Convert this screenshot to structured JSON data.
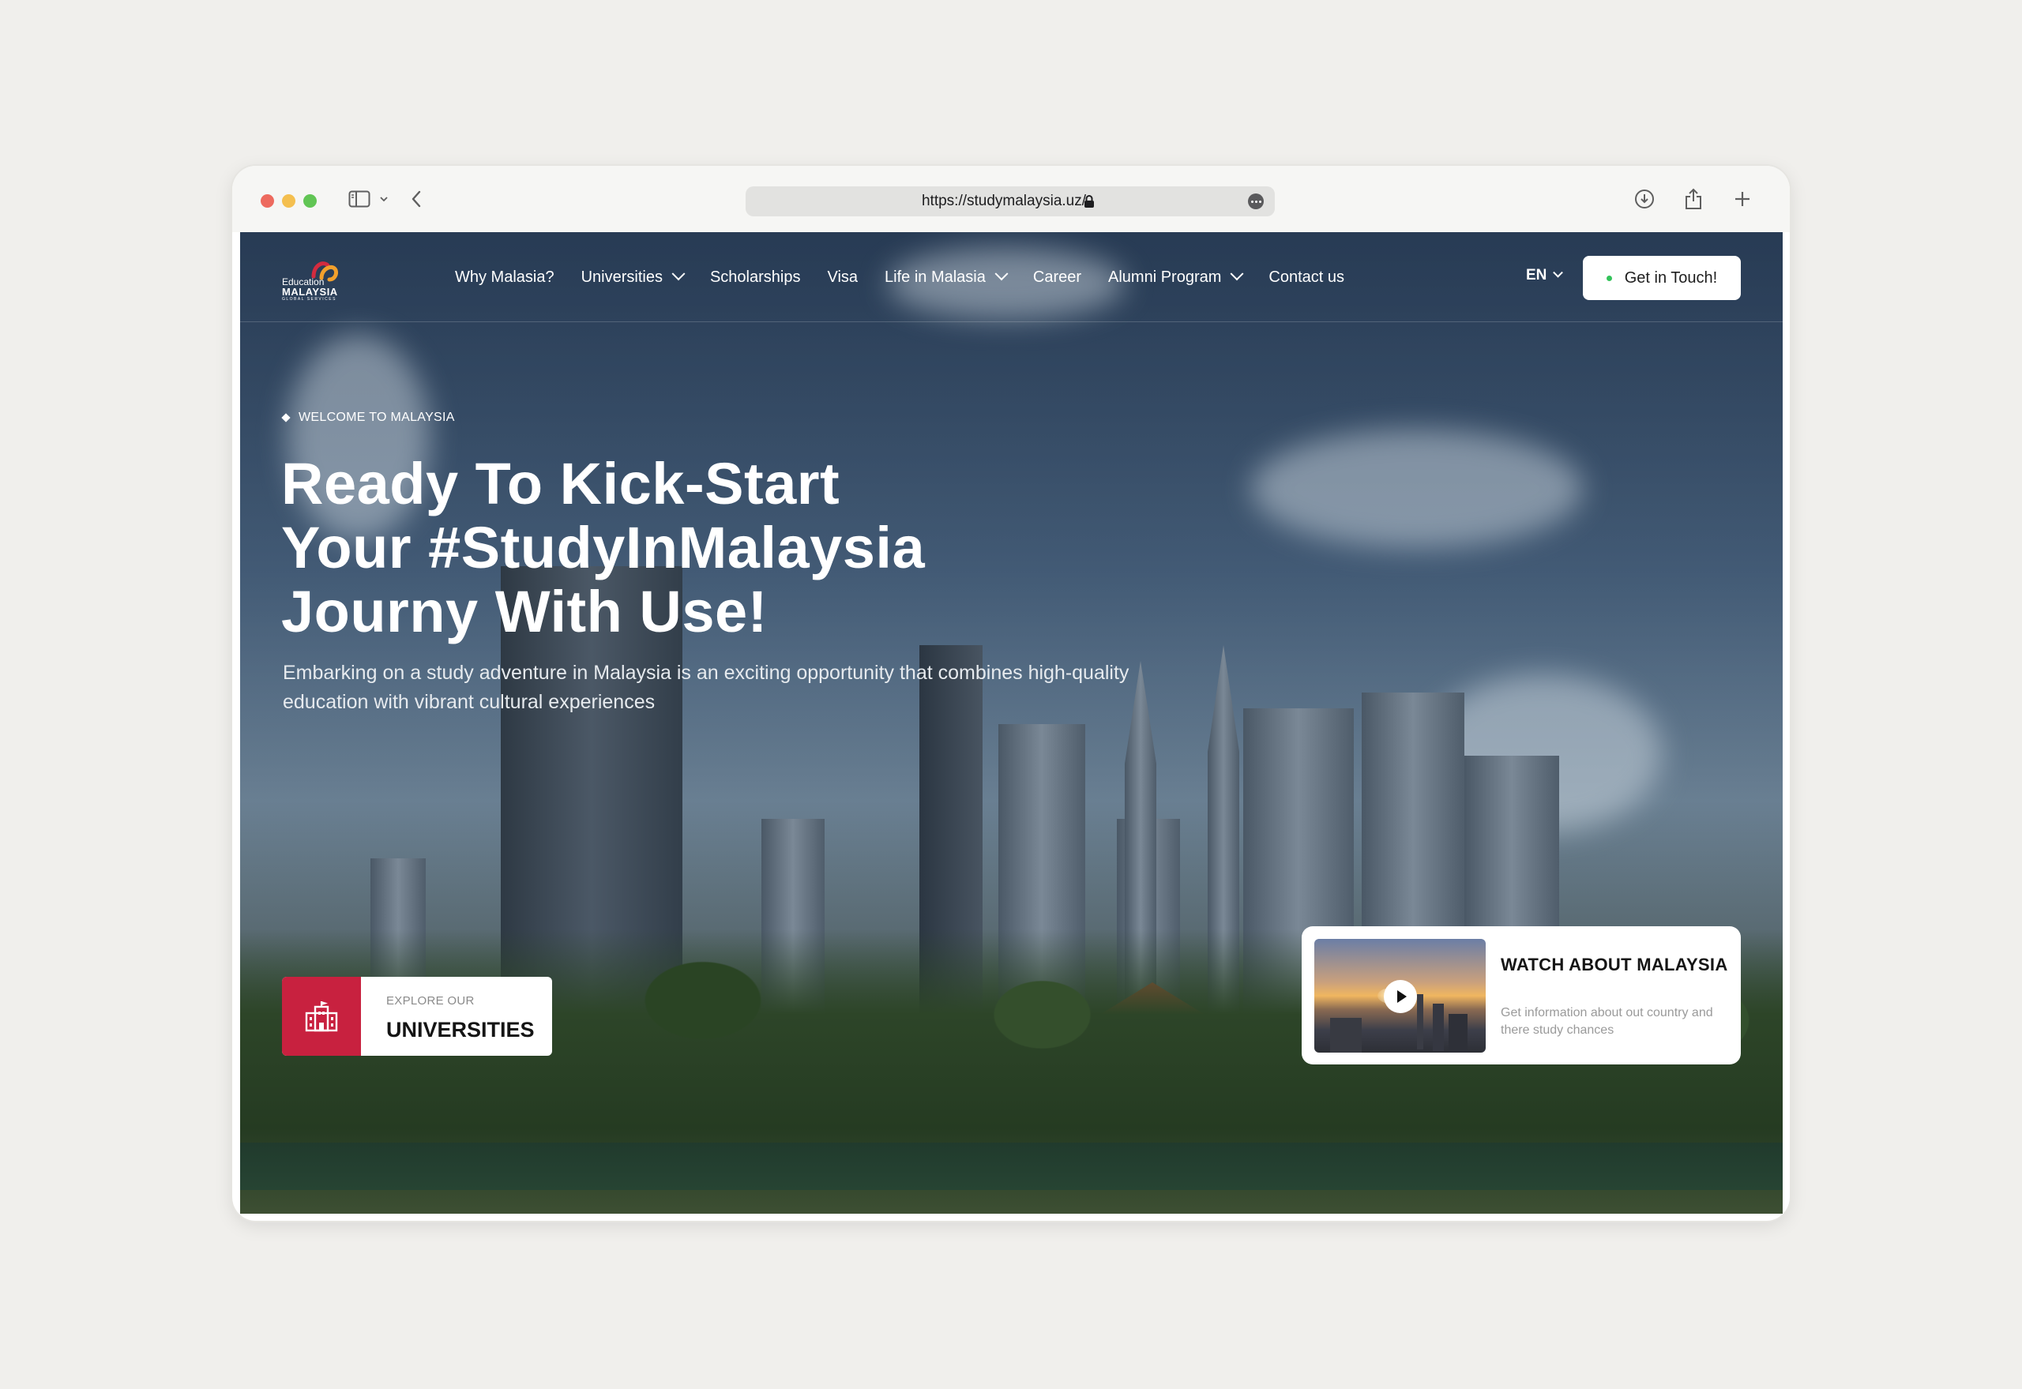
{
  "browser": {
    "url": "https://studymalaysia.uz/"
  },
  "logo": {
    "line1": "Education",
    "line2": "MALAYSIA",
    "line3": "GLOBAL SERVICES"
  },
  "nav": {
    "items": [
      {
        "label": "Why Malasia?",
        "dropdown": false
      },
      {
        "label": "Universities",
        "dropdown": true
      },
      {
        "label": "Scholarships",
        "dropdown": false
      },
      {
        "label": "Visa",
        "dropdown": false
      },
      {
        "label": "Life in Malasia",
        "dropdown": true
      },
      {
        "label": "Career",
        "dropdown": false
      },
      {
        "label": "Alumni Program",
        "dropdown": true
      },
      {
        "label": "Contact us",
        "dropdown": false
      }
    ],
    "language": "EN",
    "cta_label": "Get in Touch!"
  },
  "hero": {
    "kicker": "WELCOME TO MALAYSIA",
    "headline": [
      "Ready To Kick-Start",
      "Your #StudyInMalaysia",
      "Journy With Use!"
    ],
    "lede": "Embarking on a study adventure in Malaysia is an exciting opportunity that combines high-quality education with vibrant cultural experiences"
  },
  "universities_card": {
    "kicker": "EXPLORE OUR",
    "title": "UNIVERSITIES",
    "icon": "university-building-icon"
  },
  "video_card": {
    "title": "WATCH ABOUT MALAYSIA",
    "subtitle": "Get information about out country and there study chances",
    "icon": "play-icon"
  },
  "colors": {
    "accent": "#c8213f",
    "status_dot": "#33c35a",
    "background": "#f0efec"
  }
}
